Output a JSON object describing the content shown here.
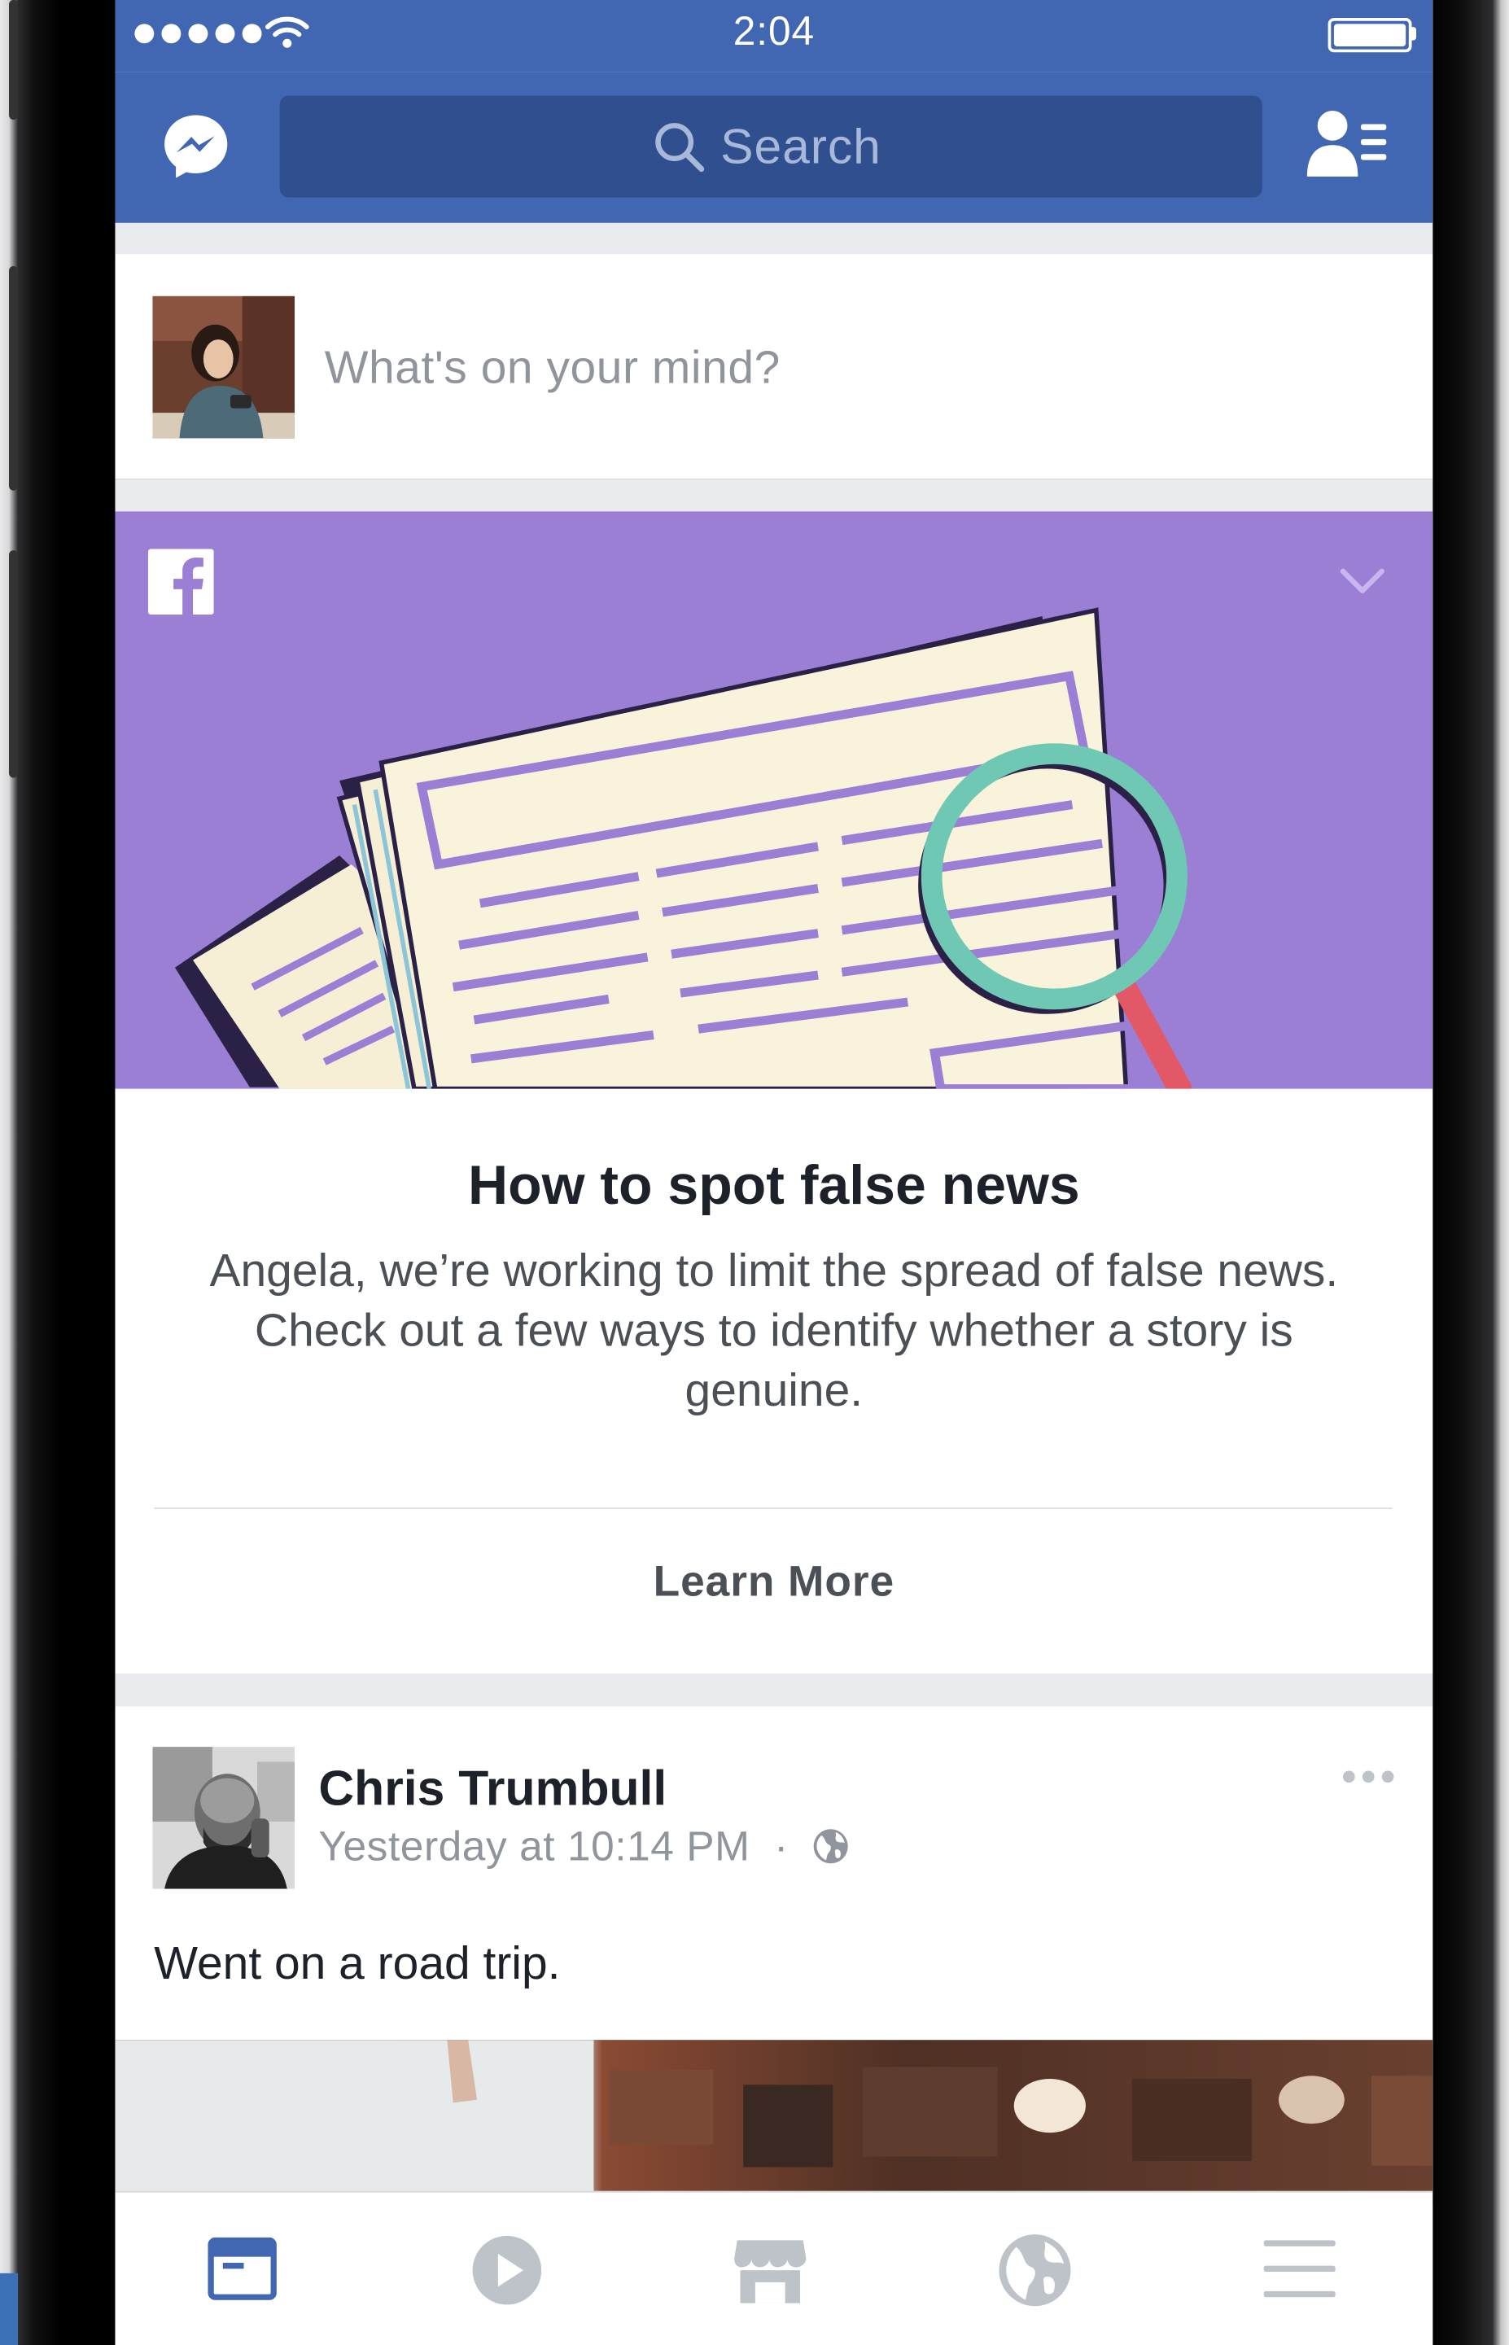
{
  "status_bar": {
    "time": "2:04",
    "signal_dots": 5,
    "battery_level": 1.0
  },
  "nav": {
    "search_placeholder": "Search",
    "messenger_icon": "messenger-icon",
    "friend_requests_icon": "friend-requests-icon"
  },
  "composer": {
    "prompt": "What's on your mind?"
  },
  "info_card": {
    "title": "How to spot false news",
    "body": "Angela, we’re working to limit the spread of false news. Check out a few ways to identify whether a story is genuine.",
    "action_label": "Learn More",
    "banner_color": "#9b7fd5"
  },
  "post": {
    "author": "Chris Trumbull",
    "timestamp": "Yesterday at 10:14 PM",
    "separator": "·",
    "text": "Went on a road trip."
  },
  "tab_bar": {
    "tabs": [
      "news-feed-icon",
      "video-icon",
      "marketplace-icon",
      "notifications-globe-icon",
      "menu-icon"
    ],
    "active_index": 0
  },
  "colors": {
    "brand_blue": "#4267b2",
    "search_bg": "#2f4f8f",
    "active_tab": "#4267b2",
    "inactive_tab": "#bec2c9"
  }
}
